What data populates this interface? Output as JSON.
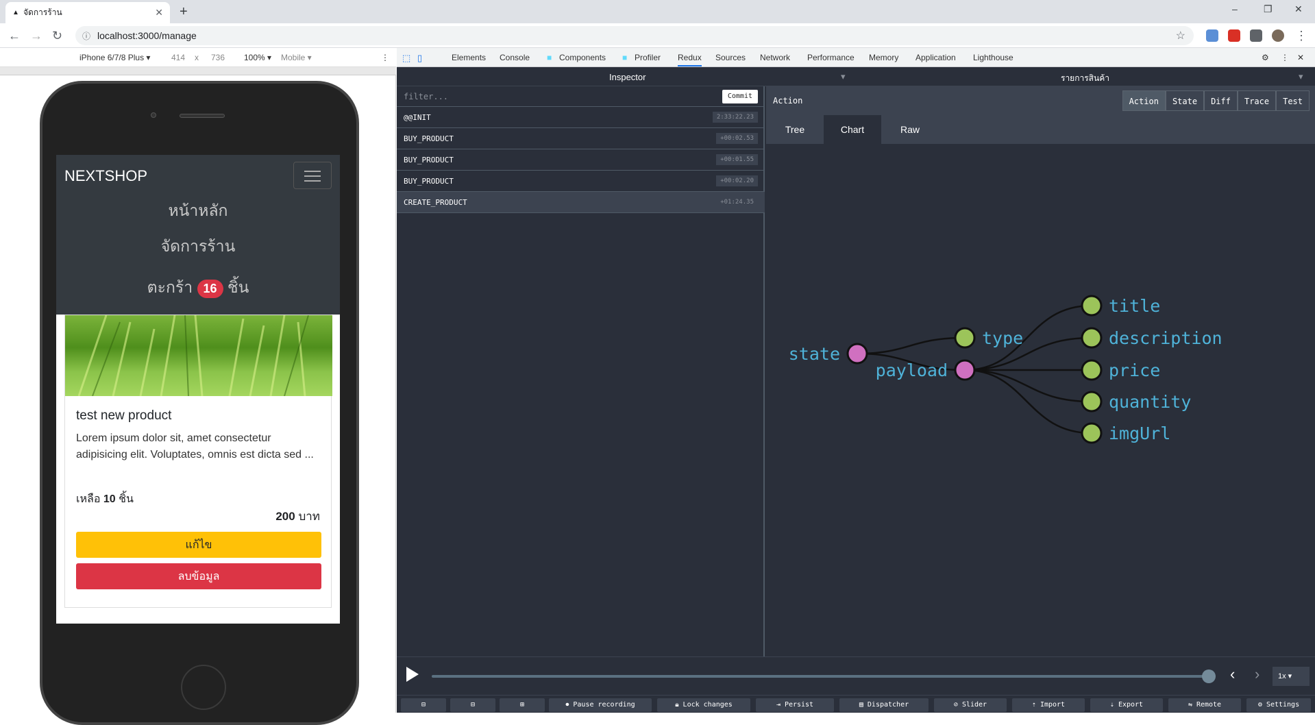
{
  "browser": {
    "tab_title": "จัดการร้าน",
    "new_tab": "+",
    "url": "localhost:3000/manage",
    "win_min": "–",
    "win_max": "❐",
    "win_close": "✕"
  },
  "device_toolbar": {
    "device": "iPhone 6/7/8 Plus ▾",
    "width": "414",
    "times": "x",
    "height": "736",
    "zoom": "100% ▾",
    "mode": "Mobile ▾"
  },
  "app": {
    "brand": "NEXTSHOP",
    "nav_home": "หน้าหลัก",
    "nav_manage": "จัดการร้าน",
    "nav_cart_prefix": "ตะกร้า",
    "cart_count": "16",
    "nav_cart_suffix": "ชิ้น",
    "card": {
      "title": "test new product",
      "description": "Lorem ipsum dolor sit, amet consectetur adipisicing elit. Voluptates, omnis est dicta sed ...",
      "stock_prefix": "เหลือ",
      "stock_count": "10",
      "stock_suffix": "ชิ้น",
      "price": "200",
      "currency": "บาท",
      "edit_label": "แก้ไข",
      "delete_label": "ลบข้อมูล"
    }
  },
  "devtools": {
    "tabs": [
      "Elements",
      "Console",
      "Components",
      "Profiler",
      "Redux",
      "Sources",
      "Network",
      "Performance",
      "Memory",
      "Application",
      "Lighthouse"
    ],
    "active_tab": "Redux"
  },
  "redux": {
    "inspector_label": "Inspector",
    "instance_label": "รายการสินค้า",
    "filter_placeholder": "filter...",
    "commit_label": "Commit",
    "actions": [
      {
        "name": "@@INIT",
        "time": "2:33:22.23"
      },
      {
        "name": "BUY_PRODUCT",
        "time": "+00:02.53"
      },
      {
        "name": "BUY_PRODUCT",
        "time": "+00:01.55"
      },
      {
        "name": "BUY_PRODUCT",
        "time": "+00:02.20"
      },
      {
        "name": "CREATE_PRODUCT",
        "time": "+01:24.35"
      }
    ],
    "detail_label": "Action",
    "segments": [
      "Action",
      "State",
      "Diff",
      "Trace",
      "Test"
    ],
    "subtabs": [
      "Tree",
      "Chart",
      "Raw"
    ],
    "tree": {
      "root": "state",
      "level1": [
        "type",
        "payload"
      ],
      "payload_children": [
        "title",
        "description",
        "price",
        "quantity",
        "imgUrl"
      ]
    },
    "speed": "1x ▾",
    "buttons": [
      "Pause recording",
      "Lock changes",
      "Persist",
      "Dispatcher",
      "Slider",
      "Import",
      "Export",
      "Remote",
      "Settings"
    ]
  },
  "colors": {
    "navbar": "#343a40",
    "badge": "#dc3545",
    "edit": "#ffc107",
    "delete": "#dc3545",
    "redux_bg": "#2a2f3a",
    "node_parent": "#d070c0",
    "node_leaf": "#9cc45a",
    "node_label": "#4fb3d9"
  }
}
